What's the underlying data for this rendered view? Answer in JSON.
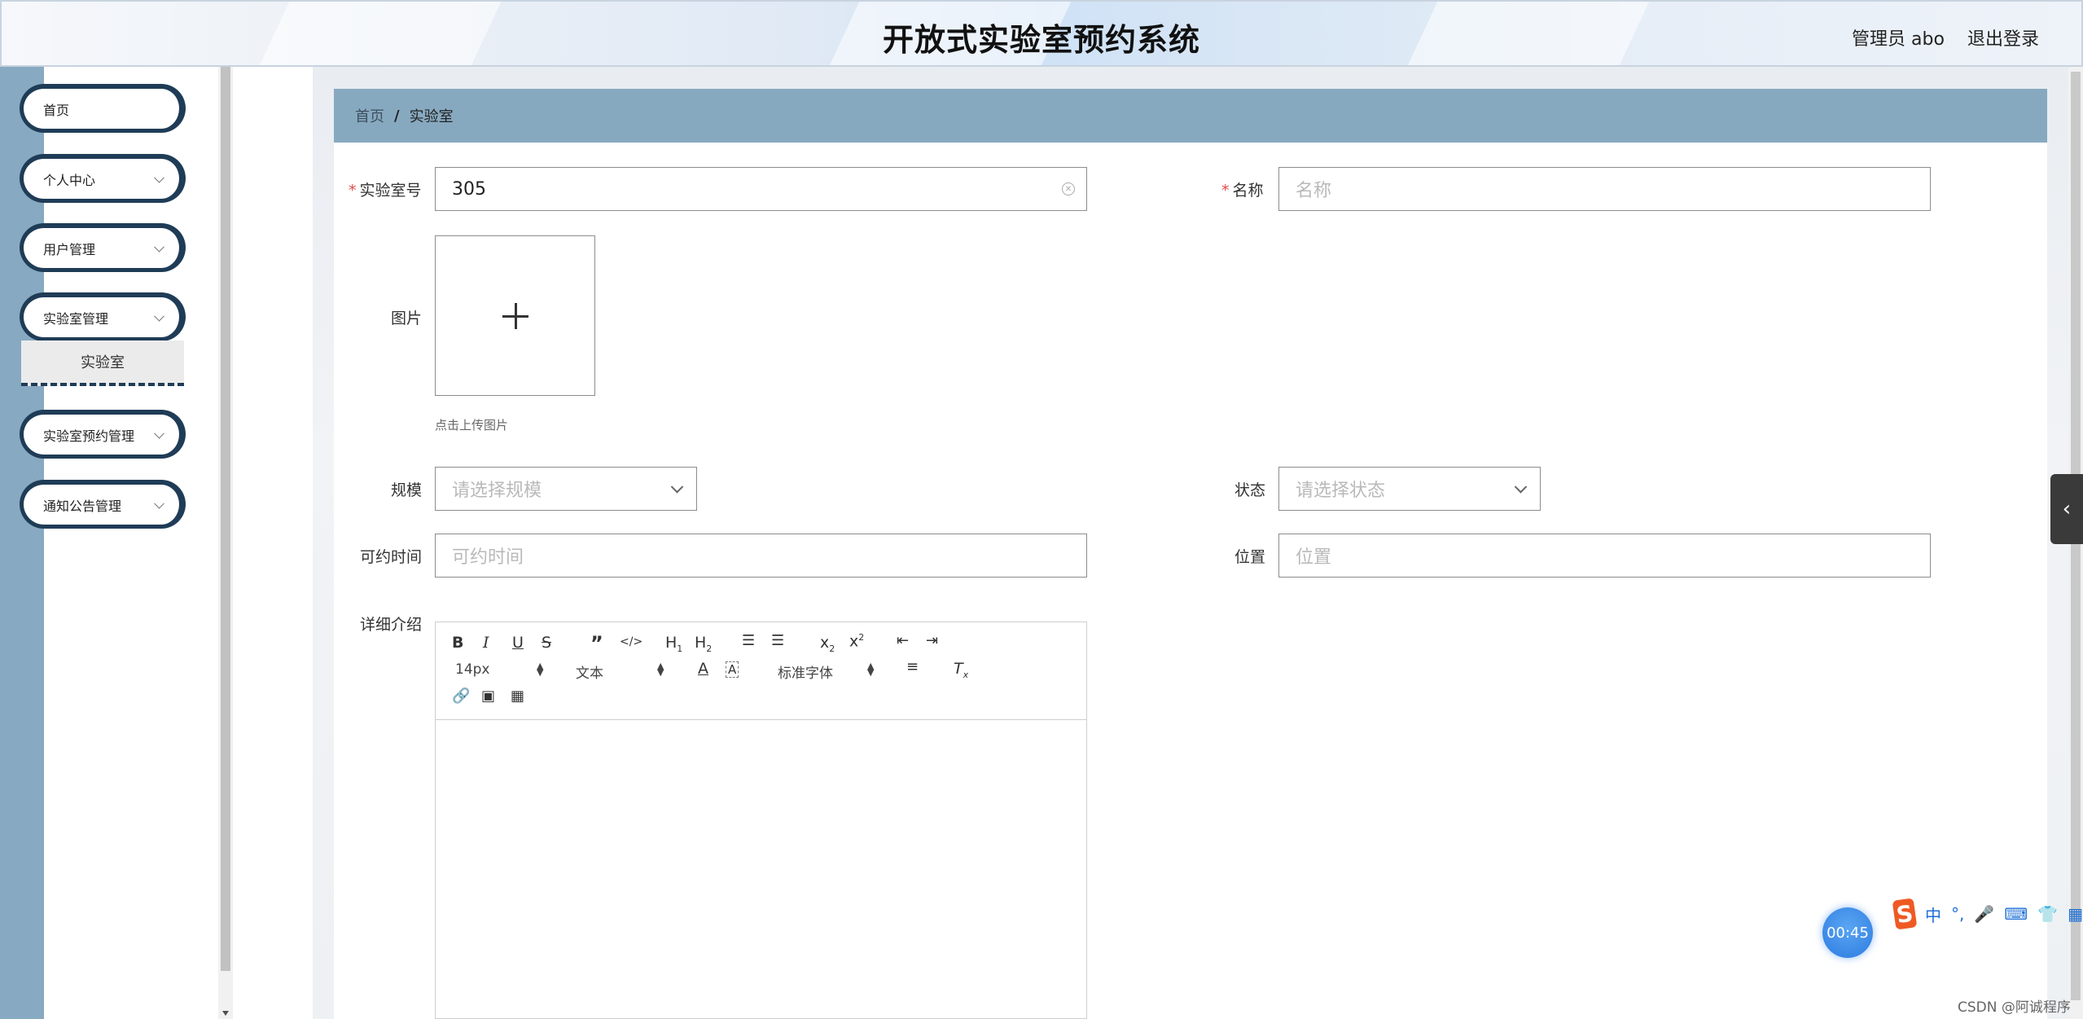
{
  "header": {
    "title": "开放式实验室预约系统",
    "admin": "管理员 abo",
    "logout": "退出登录"
  },
  "sidebar": {
    "items": [
      {
        "label": "首页",
        "has_arrow": false
      },
      {
        "label": "个人中心",
        "has_arrow": true
      },
      {
        "label": "用户管理",
        "has_arrow": true
      },
      {
        "label": "实验室管理",
        "has_arrow": true
      },
      {
        "label": "实验室预约管理",
        "has_arrow": true
      },
      {
        "label": "通知公告管理",
        "has_arrow": true
      }
    ],
    "submenu_active": "实验室"
  },
  "breadcrumb": {
    "home": "首页",
    "separator": "/",
    "current": "实验室"
  },
  "form": {
    "lab_no": {
      "label": "实验室号",
      "value": "305",
      "required": true
    },
    "name": {
      "label": "名称",
      "placeholder": "名称",
      "required": true
    },
    "image": {
      "label": "图片",
      "hint": "点击上传图片"
    },
    "scale": {
      "label": "规模",
      "placeholder": "请选择规模"
    },
    "status": {
      "label": "状态",
      "placeholder": "请选择状态"
    },
    "available_time": {
      "label": "可约时间",
      "placeholder": "可约时间"
    },
    "location": {
      "label": "位置",
      "placeholder": "位置"
    },
    "detail": {
      "label": "详细介绍"
    }
  },
  "editor": {
    "font_size": "14px",
    "text_style": "文本",
    "font_family": "标准字体"
  },
  "overlay": {
    "timer": "00:45",
    "ime_mode": "中",
    "watermark": "CSDN @阿诚程序"
  },
  "colors": {
    "sidebar_strip": "#87a9c2",
    "breadcrumb_bg": "#87a9c0",
    "menu_border": "#1f3c57",
    "required": "#e04b4b"
  }
}
